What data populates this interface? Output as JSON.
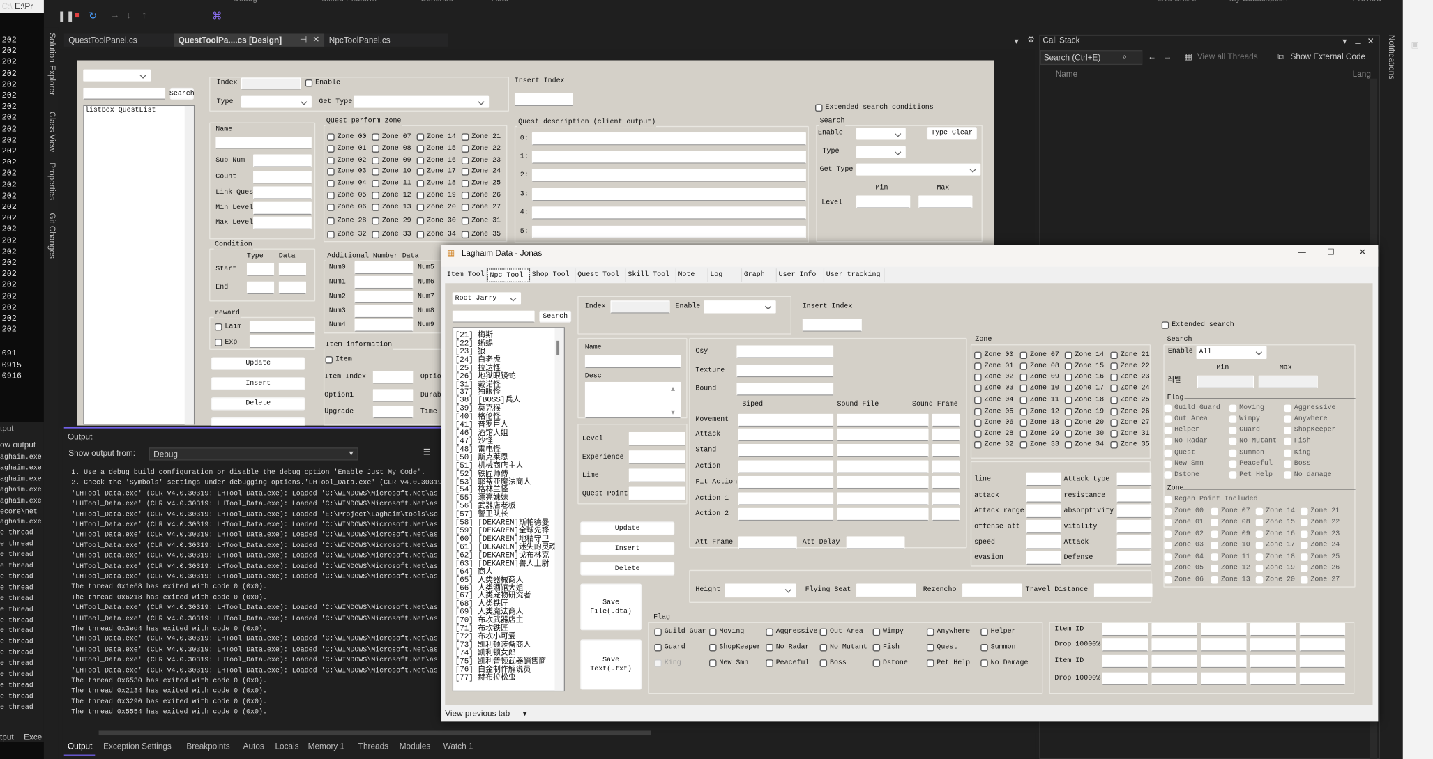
{
  "vs": {
    "top_menu": [
      "Debug",
      "Mixed Platform",
      "Continue",
      "Auto",
      "Live Share",
      "My Subscription",
      "Preview"
    ],
    "console_title": "E:\\Pr",
    "console_lines": [
      "202",
      "202",
      "202",
      "202",
      "202",
      "202",
      "202",
      "202",
      "202",
      "202",
      "202",
      "202",
      "202",
      "202",
      "202",
      "202",
      "202",
      "202",
      "202",
      "202",
      "202",
      "202",
      "202",
      "202",
      "202",
      "202",
      "202",
      "091",
      "0915",
      "0916"
    ],
    "side_tabs": [
      "Solution Explorer",
      "Class View",
      "Properties",
      "Git Changes"
    ],
    "doc_tabs": [
      {
        "label": "QuestToolPanel.cs"
      },
      {
        "label": "QuestToolPa....cs [Design]",
        "active": true
      },
      {
        "label": "NpcToolPanel.cs"
      }
    ],
    "call_stack": {
      "title": "Call Stack",
      "search_placeholder": "Search (Ctrl+E)",
      "view_all_threads": "View all Threads",
      "show_external_code": "Show External Code",
      "col_name": "Name",
      "col_lang": "Lang"
    },
    "notifications": "Notifications",
    "output": {
      "title": "Output",
      "show_from_label": "Show output from:",
      "source": "Debug",
      "lines": [
        "1. Use a debug build configuration or disable the debug option 'Enable Just My Code'.",
        "2. Check the 'Symbols' settings under debugging options.'LHTool_Data.exe' (CLR v4.0.30319",
        "'LHTool_Data.exe' (CLR v4.0.30319: LHTool_Data.exe): Loaded 'C:\\WINDOWS\\Microsoft.Net\\as",
        "'LHTool_Data.exe' (CLR v4.0.30319: LHTool_Data.exe): Loaded 'C:\\WINDOWS\\Microsoft.Net\\as",
        "'LHTool_Data.exe' (CLR v4.0.30319: LHTool_Data.exe): Loaded 'E:\\Project\\Laghaim\\tools\\So",
        "'LHTool_Data.exe' (CLR v4.0.30319: LHTool_Data.exe): Loaded 'C:\\WINDOWS\\Microsoft.Net\\as",
        "'LHTool_Data.exe' (CLR v4.0.30319: LHTool_Data.exe): Loaded 'C:\\WINDOWS\\Microsoft.Net\\as",
        "'LHTool_Data.exe' (CLR v4.0.30319: LHTool_Data.exe): Loaded 'C:\\WINDOWS\\Microsoft.Net\\as",
        "'LHTool_Data.exe' (CLR v4.0.30319: LHTool_Data.exe): Loaded 'C:\\WINDOWS\\Microsoft.Net\\as",
        "'LHTool_Data.exe' (CLR v4.0.30319: LHTool_Data.exe): Loaded 'C:\\WINDOWS\\Microsoft.Net\\as",
        "'LHTool_Data.exe' (CLR v4.0.30319: LHTool_Data.exe): Loaded 'C:\\WINDOWS\\Microsoft.Net\\as",
        "The thread 0x1e68 has exited with code 0 (0x0).",
        "The thread 0x6218 has exited with code 0 (0x0).",
        "'LHTool_Data.exe' (CLR v4.0.30319: LHTool_Data.exe): Loaded 'C:\\WINDOWS\\Microsoft.Net\\as",
        "'LHTool_Data.exe' (CLR v4.0.30319: LHTool_Data.exe): Loaded 'C:\\WINDOWS\\Microsoft.Net\\as",
        "The thread 0x3ed4 has exited with code 0 (0x0).",
        "'LHTool_Data.exe' (CLR v4.0.30319: LHTool_Data.exe): Loaded 'C:\\WINDOWS\\Microsoft.Net\\as",
        "'LHTool_Data.exe' (CLR v4.0.30319: LHTool_Data.exe): Loaded 'C:\\WINDOWS\\Microsoft.Net\\as",
        "'LHTool_Data.exe' (CLR v4.0.30319: LHTool_Data.exe): Loaded 'C:\\WINDOWS\\Microsoft.Net\\as",
        "'LHTool_Data.exe' (CLR v4.0.30319: LHTool_Data.exe): Loaded 'C:\\WINDOWS\\Microsoft.Net\\as",
        "The thread 0x6530 has exited with code 0 (0x0).",
        "The thread 0x2134 has exited with code 0 (0x0).",
        "The thread 0x3290 has exited with code 0 (0x0).",
        "The thread 0x5554 has exited with code 0 (0x0)."
      ]
    },
    "bottom_tabs": [
      "Output",
      "Exception Settings",
      "Breakpoints",
      "Autos",
      "Locals",
      "Memory 1",
      "Threads",
      "Modules",
      "Watch 1"
    ],
    "bg_output": {
      "title": "tput",
      "show": "ow output",
      "lines": [
        "aghaim.exe",
        "aghaim.exe",
        "aghaim.exe",
        "aghaim.exe",
        "aghaim.exe",
        "ecore\\net",
        "aghaim.exe",
        "e thread",
        "e thread",
        "e thread",
        "e thread",
        "e thread",
        "e thread",
        "e thread",
        "e thread",
        "e thread",
        "e thread",
        "e thread",
        "e thread",
        "e thread",
        "e thread",
        "e thread",
        "e thread",
        "e thread"
      ],
      "tabs": [
        "tput",
        "Exce"
      ]
    }
  },
  "quest_form": {
    "search_button": "Search",
    "listbox": "listBox_QuestList",
    "index_label": "Index",
    "enable_label": "Enable",
    "type_label": "Type",
    "get_type_label": "Get Type",
    "insert_index_label": "Insert Index",
    "extended_search": "Extended search conditions",
    "name_fields": [
      "Name",
      "Sub Num",
      "Count",
      "Link Ques",
      "Min Level",
      "Max Level"
    ],
    "zone_title": "Quest perform zone",
    "zones": [
      "Zone 00",
      "Zone 07",
      "Zone 14",
      "Zone 21",
      "Zone 01",
      "Zone 08",
      "Zone 15",
      "Zone 22",
      "Zone 02",
      "Zone 09",
      "Zone 16",
      "Zone 23",
      "Zone 03",
      "Zone 10",
      "Zone 17",
      "Zone 24",
      "Zone 04",
      "Zone 11",
      "Zone 18",
      "Zone 25",
      "Zone 05",
      "Zone 12",
      "Zone 19",
      "Zone 26",
      "Zone 06",
      "Zone 13",
      "Zone 20",
      "Zone 27",
      "Zone 28",
      "Zone 29",
      "Zone 30",
      "Zone 31",
      "Zone 32",
      "Zone 33",
      "Zone 34",
      "Zone 35"
    ],
    "desc_title": "Quest description (client output)",
    "desc_rows": [
      "0:",
      "1:",
      "2:",
      "3:",
      "4:",
      "5:"
    ],
    "search": {
      "title": "Search",
      "enable": "Enable",
      "type_clear": "Type Clear",
      "type": "Type",
      "get_type": "Get Type",
      "min": "Min",
      "max": "Max",
      "level": "Level"
    },
    "condition": {
      "title": "Condition",
      "type": "Type",
      "data": "Data",
      "start": "Start",
      "end": "End"
    },
    "reward": {
      "title": "reward",
      "laim": "Laim",
      "exp": "Exp"
    },
    "buttons": [
      "Update",
      "Insert",
      "Delete"
    ],
    "addnum": {
      "title": "Additional Number Data",
      "left": [
        "Num0",
        "Num1",
        "Num2",
        "Num3",
        "Num4"
      ],
      "right": [
        "Num5",
        "Num6",
        "Num7",
        "Num8",
        "Num9"
      ]
    },
    "item_info": {
      "title": "Item information",
      "item": "Item",
      "labels": [
        "Item Index",
        "Option1",
        "Upgrade"
      ],
      "right_labels": [
        "Optio",
        "Durab",
        "Time"
      ]
    }
  },
  "laghaim": {
    "title": "Laghaim Data - Jonas",
    "tabs": [
      "Item Tool",
      "Npc Tool",
      "Shop Tool",
      "Quest Tool",
      "Skill Tool",
      "Note",
      "Log",
      "Graph",
      "User Info",
      "User tracking"
    ],
    "active_tab": "Npc Tool",
    "root_select": "Root Jarry",
    "search_button": "Search",
    "npc_list": [
      "[21] 梅斯",
      "[22] 蜥蜴",
      "[23] 狼",
      "[24] 白老虎",
      "[25] 拉达怪",
      "[26] 地狱眼镜蛇",
      "[31] 戴诺怪",
      "[37] 独眼怪",
      "[38] [BOSS]兵人",
      "[39] 莫克猴",
      "[40] 格伦怪",
      "[41] 普罗巨人",
      "[46] 酒馆大姐",
      "[47] 沙怪",
      "[48] 雷电怪",
      "[50] 斯克莱恩",
      "[51] 机械商店主人",
      "[52] 铁匠师傅",
      "[53] 耶蒂亚魔法商人",
      "[54] 格林兰怪",
      "[55] 漂亮妹妹",
      "[56] 武器店老板",
      "[57] 警卫队长",
      "[58] [DEKAREN]斯帕德曼",
      "[59] [DEKAREN]全球先锋",
      "[60] [DEKAREN]地精守卫",
      "[61] [DEKAREN]迷失的灵魂",
      "[62] [DEKAREN]戈布林克",
      "[63] [DEKAREN]兽人上尉",
      "[64] 商人",
      "[65] 人类器械商人",
      "[66] 人类酒馆大姐",
      "[67] 人类宠物研究者",
      "[68] 人类铁匠",
      "[69] 人类魔法商人",
      "[70] 布坎武器店主",
      "[71] 布坎铁匠",
      "[72] 布坎小可爱",
      "[73] 凯利顿装备商人",
      "[74] 凯利顿女郎",
      "[75] 凯利普顿武器销售商",
      "[76] 白金制作解说员",
      "[77] 赫布拉松虫"
    ],
    "index_label": "Index",
    "enable_label": "Enable",
    "insert_index_label": "Insert Index",
    "name_label": "Name",
    "desc_label": "Desc",
    "stats_left": [
      "Level",
      "Experience",
      "Lime",
      "Quest Point"
    ],
    "buttons": [
      "Update",
      "Insert",
      "Delete"
    ],
    "save_file": "Save\nFile(.dta)",
    "save_text": "Save\nText(.txt)",
    "model": {
      "fields": [
        "Csy",
        "Texture",
        "Bound"
      ],
      "headers": [
        "Biped",
        "Sound File",
        "Sound Frame"
      ],
      "rows": [
        "Movement",
        "Attack",
        "Stand",
        "Action",
        "Fit Action",
        "Action 1",
        "Action 2"
      ],
      "att_frame": "Att Frame",
      "att_delay": "Att Delay"
    },
    "zone_title": "Zone",
    "zones": [
      "Zone 00",
      "Zone 07",
      "Zone 14",
      "Zone 21",
      "Zone 01",
      "Zone 08",
      "Zone 15",
      "Zone 22",
      "Zone 02",
      "Zone 09",
      "Zone 16",
      "Zone 23",
      "Zone 03",
      "Zone 10",
      "Zone 17",
      "Zone 24",
      "Zone 04",
      "Zone 11",
      "Zone 18",
      "Zone 25",
      "Zone 05",
      "Zone 12",
      "Zone 19",
      "Zone 26",
      "Zone 06",
      "Zone 13",
      "Zone 20",
      "Zone 27",
      "Zone 28",
      "Zone 29",
      "Zone 30",
      "Zone 31",
      "Zone 32",
      "Zone 33",
      "Zone 34",
      "Zone 35"
    ],
    "combat": {
      "left": [
        "line",
        "attack",
        "Attack range",
        "offense att",
        "speed",
        "evasion"
      ],
      "right": [
        "Attack type",
        "resistance",
        "absorptivity",
        "vitality",
        "Attack",
        "Defense"
      ]
    },
    "height_label": "Height",
    "flying_seat": "Flying Seat",
    "rezencho": "Rezencho",
    "travel_distance": "Travel Distance",
    "flag_title": "Flag",
    "flags": [
      {
        "label": "Guild Guar"
      },
      {
        "label": "Moving"
      },
      {
        "label": "Aggressive"
      },
      {
        "label": "Out Area"
      },
      {
        "label": "Wimpy"
      },
      {
        "label": "Anywhere"
      },
      {
        "label": "Helper"
      },
      {
        "label": "Guard"
      },
      {
        "label": "ShopKeeper"
      },
      {
        "label": "No Radar"
      },
      {
        "label": "No Mutant"
      },
      {
        "label": "Fish"
      },
      {
        "label": "Quest"
      },
      {
        "label": "Summon"
      },
      {
        "label": "King",
        "disabled": true
      },
      {
        "label": "New Smn"
      },
      {
        "label": "Peaceful"
      },
      {
        "label": "Boss"
      },
      {
        "label": "Dstone"
      },
      {
        "label": "Pet Help"
      },
      {
        "label": "No Damage"
      }
    ],
    "drops": [
      "Item ID",
      "Drop 10000%",
      "Item ID",
      "Drop 10000%"
    ],
    "extended_search": "Extended search",
    "search": {
      "title": "Search",
      "enable": "Enable",
      "enable_value": "All",
      "min": "Min",
      "max": "Max",
      "level": "레벨",
      "flag_title": "Flag",
      "flags": [
        "Guild Guard",
        "Moving",
        "Aggressive",
        "Out Area",
        "Wimpy",
        "Anywhere",
        "Helper",
        "Guard",
        "ShopKeeper",
        "No Radar",
        "No Mutant",
        "Fish",
        "Quest",
        "Summon",
        "King",
        "New Smn",
        "Peaceful",
        "Boss",
        "Dstone",
        "Pet Help",
        "No damage"
      ],
      "zone_title": "Zone",
      "regen": "Regen Point Included",
      "zones": [
        "Zone 00",
        "Zone 07",
        "Zone 14",
        "Zone 21",
        "Zone 01",
        "Zone 08",
        "Zone 15",
        "Zone 22",
        "Zone 02",
        "Zone 09",
        "Zone 16",
        "Zone 23",
        "Zone 03",
        "Zone 10",
        "Zone 17",
        "Zone 24",
        "Zone 04",
        "Zone 11",
        "Zone 18",
        "Zone 25",
        "Zone 05",
        "Zone 12",
        "Zone 19",
        "Zone 26",
        "Zone 06",
        "Zone 13",
        "Zone 20",
        "Zone 27"
      ]
    },
    "footer": "View previous tab"
  },
  "colors": {
    "vs_bg": "#1f1f1f",
    "form_bg": "#d4d0c8",
    "accent": "#7160e8",
    "stop": "#e04040"
  }
}
